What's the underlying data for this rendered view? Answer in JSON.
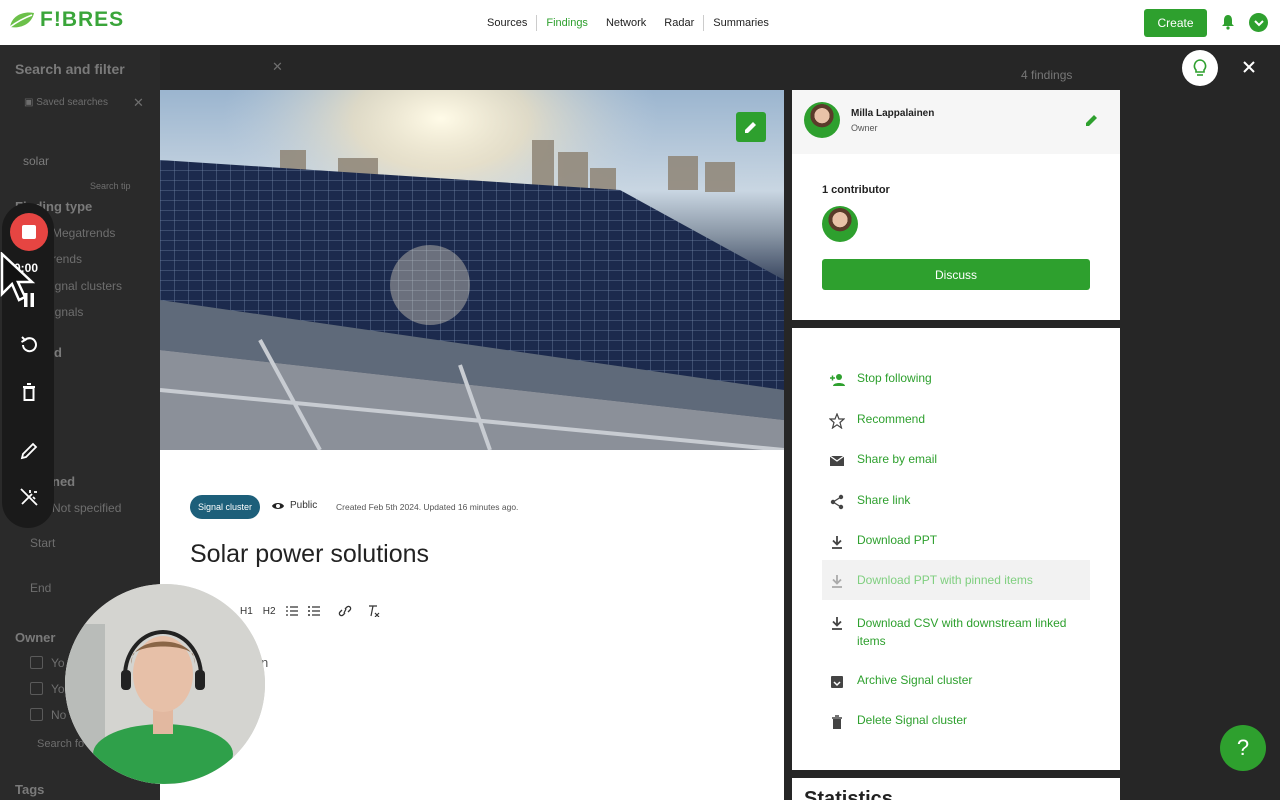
{
  "brand": {
    "name": "F!BRES",
    "color": "#2ea02e"
  },
  "nav": {
    "items": [
      "Sources",
      "Findings",
      "Network",
      "Radar",
      "Summaries"
    ],
    "active": "Findings"
  },
  "header": {
    "create_label": "Create"
  },
  "background": {
    "search_title": "Search and filter",
    "saved_searches": "Saved searches",
    "search_value": "solar",
    "search_hint": "Search tip",
    "finding_type_label": "Finding type",
    "finding_types": [
      "Megatrends",
      "rends",
      "ignal clusters",
      "ignals"
    ],
    "partial_d": "d",
    "partial_ned": "ned",
    "not_specified": "Not specified",
    "start_label": "Start",
    "end_label": "End",
    "owner_label": "Owner",
    "owner_options": [
      "Yo",
      "Yo",
      "No"
    ],
    "owner_search": "Search fo",
    "tags_label": "Tags",
    "findings_count": "4 findings"
  },
  "finding": {
    "type_badge": "Signal cluster",
    "visibility": "Public",
    "created_text": "Created Feb 5th 2024. Updated 16 minutes ago.",
    "title": "Solar power solutions",
    "toolbar": [
      "H1",
      "H2"
    ],
    "description_placeholder": "ption"
  },
  "owner": {
    "name": "Milla Lappalainen",
    "role": "Owner"
  },
  "contributors": {
    "label": "1 contributor"
  },
  "discuss_label": "Discuss",
  "actions": [
    {
      "label": "Stop following",
      "icon": "person-add-icon"
    },
    {
      "label": "Recommend",
      "icon": "star-icon"
    },
    {
      "label": "Share by email",
      "icon": "mail-icon"
    },
    {
      "label": "Share link",
      "icon": "share-icon"
    },
    {
      "label": "Download PPT",
      "icon": "download-icon"
    },
    {
      "label": "Download PPT with pinned items",
      "icon": "download-icon"
    },
    {
      "label": "Download CSV with downstream linked items",
      "icon": "download-icon"
    },
    {
      "label": "Archive Signal cluster",
      "icon": "archive-icon"
    },
    {
      "label": "Delete Signal cluster",
      "icon": "trash-icon"
    }
  ],
  "stats_heading": "Statistics",
  "recorder": {
    "time": "0:00"
  },
  "help_label": "?"
}
